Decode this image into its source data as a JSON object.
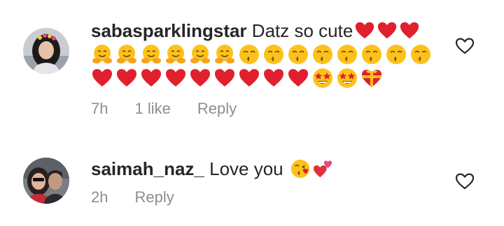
{
  "comments": [
    {
      "username": "sabasparklingstar",
      "text": "Datz so cute",
      "inline_emojis": [
        "red-heart",
        "red-heart",
        "red-heart"
      ],
      "emoji_lines": [
        [
          "hugging-face",
          "hugging-face",
          "hugging-face",
          "hugging-face",
          "hugging-face",
          "hugging-face",
          "kissing-smiling-eyes",
          "kissing-smiling-eyes",
          "kissing-smiling-eyes",
          "kissing-smiling-eyes",
          "kissing-smiling-eyes",
          "kissing-smiling-eyes",
          "kissing-smiling-eyes",
          "kissing-smiling-eyes"
        ],
        [
          "red-heart",
          "red-heart",
          "red-heart",
          "red-heart",
          "red-heart",
          "red-heart",
          "red-heart",
          "red-heart",
          "red-heart",
          "star-struck",
          "star-struck",
          "heart-with-ribbon"
        ]
      ],
      "time": "7h",
      "likes": "1 like",
      "reply_label": "Reply",
      "like_icon": "heart-outline-icon"
    },
    {
      "username": "saimah_naz_",
      "text": "Love you",
      "inline_emojis": [
        "face-blowing-kiss",
        "two-hearts"
      ],
      "time": "2h",
      "reply_label": "Reply",
      "like_icon": "heart-outline-icon"
    }
  ]
}
